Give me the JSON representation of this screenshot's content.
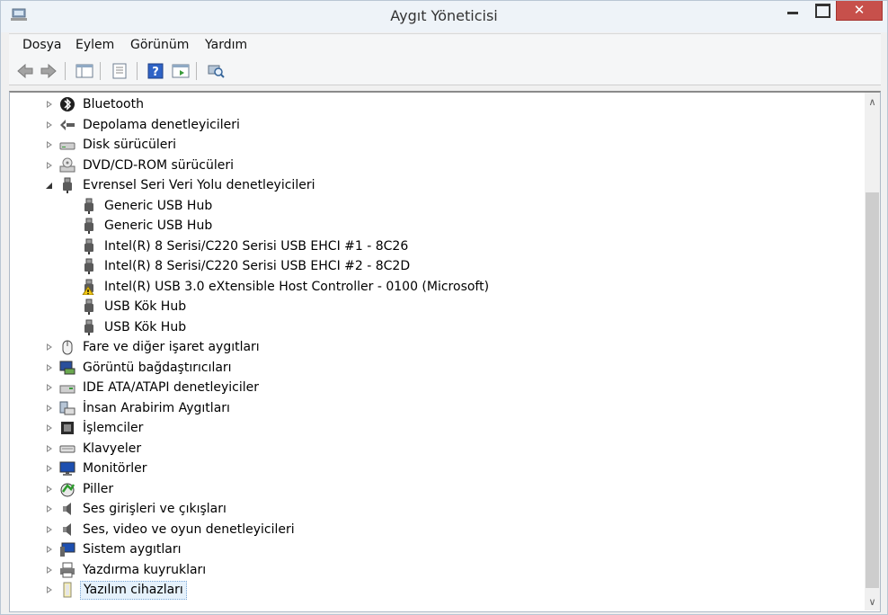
{
  "window": {
    "title": "Aygıt Yöneticisi",
    "close_label": "✕"
  },
  "menu": [
    "Dosya",
    "Eylem",
    "Görünüm",
    "Yardım"
  ],
  "toolbar": [
    "back-icon",
    "forward-icon",
    "show-hide-console-tree-icon",
    "properties-icon",
    "help-icon",
    "update-driver-icon",
    "scan-hardware-icon"
  ],
  "tree": [
    {
      "label": "Bluetooth",
      "icon": "bluetooth-icon",
      "state": "collapsed",
      "level": 0
    },
    {
      "label": "Depolama denetleyicileri",
      "icon": "storage-controller-icon",
      "state": "collapsed",
      "level": 0
    },
    {
      "label": "Disk sürücüleri",
      "icon": "disk-drive-icon",
      "state": "collapsed",
      "level": 0
    },
    {
      "label": "DVD/CD-ROM sürücüleri",
      "icon": "dvd-drive-icon",
      "state": "collapsed",
      "level": 0
    },
    {
      "label": "Evrensel Seri Veri Yolu denetleyicileri",
      "icon": "usb-icon",
      "state": "expanded",
      "level": 0
    },
    {
      "label": "Generic USB Hub",
      "icon": "usb-icon",
      "level": 1
    },
    {
      "label": "Generic USB Hub",
      "icon": "usb-icon",
      "level": 1
    },
    {
      "label": "Intel(R) 8 Serisi/C220 Serisi USB EHCI #1 - 8C26",
      "icon": "usb-icon",
      "level": 1
    },
    {
      "label": "Intel(R) 8 Serisi/C220 Serisi USB EHCI #2 - 8C2D",
      "icon": "usb-icon",
      "level": 1
    },
    {
      "label": "Intel(R) USB 3.0 eXtensible Host Controller - 0100 (Microsoft)",
      "icon": "usb-warning-icon",
      "level": 1
    },
    {
      "label": "USB Kök Hub",
      "icon": "usb-icon",
      "level": 1
    },
    {
      "label": "USB Kök Hub",
      "icon": "usb-icon",
      "level": 1
    },
    {
      "label": "Fare ve diğer işaret aygıtları",
      "icon": "mouse-icon",
      "state": "collapsed",
      "level": 0
    },
    {
      "label": "Görüntü bağdaştırıcıları",
      "icon": "display-adapter-icon",
      "state": "collapsed",
      "level": 0
    },
    {
      "label": "IDE ATA/ATAPI denetleyiciler",
      "icon": "ide-controller-icon",
      "state": "collapsed",
      "level": 0
    },
    {
      "label": "İnsan Arabirim Aygıtları",
      "icon": "hid-icon",
      "state": "collapsed",
      "level": 0
    },
    {
      "label": "İşlemciler",
      "icon": "processor-icon",
      "state": "collapsed",
      "level": 0
    },
    {
      "label": "Klavyeler",
      "icon": "keyboard-icon",
      "state": "collapsed",
      "level": 0
    },
    {
      "label": "Monitörler",
      "icon": "monitor-icon",
      "state": "collapsed",
      "level": 0
    },
    {
      "label": "Piller",
      "icon": "battery-icon",
      "state": "collapsed",
      "level": 0
    },
    {
      "label": "Ses girişleri ve çıkışları",
      "icon": "speaker-icon",
      "state": "collapsed",
      "level": 0
    },
    {
      "label": "Ses, video ve oyun denetleyicileri",
      "icon": "speaker-icon",
      "state": "collapsed",
      "level": 0
    },
    {
      "label": "Sistem aygıtları",
      "icon": "system-device-icon",
      "state": "collapsed",
      "level": 0
    },
    {
      "label": "Yazdırma kuyrukları",
      "icon": "printer-icon",
      "state": "collapsed",
      "level": 0
    },
    {
      "label": "Yazılım cihazları",
      "icon": "software-device-icon",
      "state": "collapsed",
      "level": 0,
      "selected": true
    }
  ],
  "scroll": {
    "position_fraction": 0.2
  }
}
